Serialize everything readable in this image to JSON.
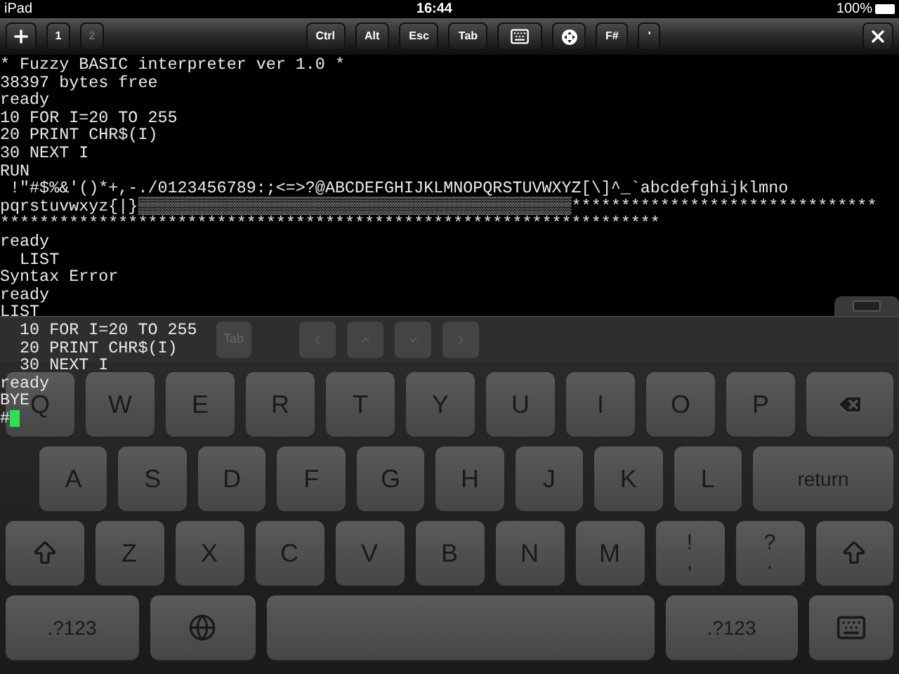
{
  "status_bar": {
    "device": "iPad",
    "time": "16:44",
    "battery": "100%"
  },
  "toolbar": {
    "sessions": [
      {
        "label": "1",
        "selected": true
      },
      {
        "label": "2",
        "selected": false
      }
    ],
    "keys": [
      "Ctrl",
      "Alt",
      "Esc",
      "Tab"
    ],
    "extra_keys": [
      "F#",
      "'"
    ]
  },
  "terminal": {
    "lines": [
      "* Fuzzy BASIC interpreter ver 1.0 *",
      "38397 bytes free",
      "ready",
      "10 FOR I=20 TO 255",
      "20 PRINT CHR$(I)",
      "30 NEXT I",
      "RUN",
      " !\"#$%&'()*+,-./0123456789:;<=>?@ABCDEFGHIJKLMNOPQRSTUVWXYZ[\\]^_`abcdefghijklmno",
      "pqrstuvwxyz{|}▒▒▒▒▒▒▒▒▒▒▒▒▒▒▒▒▒▒▒▒▒▒▒▒▒▒▒▒▒▒▒▒▒▒▒▒▒▒▒▒▒▒▒▒*******************************",
      "*******************************************************************",
      "ready",
      "  LIST",
      "Syntax Error",
      "ready",
      "LIST",
      "  10 FOR I=20 TO 255",
      "  20 PRINT CHR$(I)",
      "  30 NEXT I",
      "ready",
      "BYE",
      "#"
    ]
  },
  "accessory_bar": {
    "keys": [
      "Tab"
    ]
  },
  "keyboard": {
    "rows": [
      [
        {
          "kind": "letter",
          "label": "Q"
        },
        {
          "kind": "letter",
          "label": "W"
        },
        {
          "kind": "letter",
          "label": "E"
        },
        {
          "kind": "letter",
          "label": "R"
        },
        {
          "kind": "letter",
          "label": "T"
        },
        {
          "kind": "letter",
          "label": "Y"
        },
        {
          "kind": "letter",
          "label": "U"
        },
        {
          "kind": "letter",
          "label": "I"
        },
        {
          "kind": "letter",
          "label": "O"
        },
        {
          "kind": "letter",
          "label": "P"
        },
        {
          "kind": "backspace"
        }
      ],
      [
        {
          "kind": "letter",
          "label": "A"
        },
        {
          "kind": "letter",
          "label": "S"
        },
        {
          "kind": "letter",
          "label": "D"
        },
        {
          "kind": "letter",
          "label": "F"
        },
        {
          "kind": "letter",
          "label": "G"
        },
        {
          "kind": "letter",
          "label": "H"
        },
        {
          "kind": "letter",
          "label": "J"
        },
        {
          "kind": "letter",
          "label": "K"
        },
        {
          "kind": "letter",
          "label": "L"
        },
        {
          "kind": "return",
          "label": "return"
        }
      ],
      [
        {
          "kind": "shift"
        },
        {
          "kind": "letter",
          "label": "Z"
        },
        {
          "kind": "letter",
          "label": "X"
        },
        {
          "kind": "letter",
          "label": "C"
        },
        {
          "kind": "letter",
          "label": "V"
        },
        {
          "kind": "letter",
          "label": "B"
        },
        {
          "kind": "letter",
          "label": "N"
        },
        {
          "kind": "letter",
          "label": "M"
        },
        {
          "kind": "punct",
          "top": "!",
          "bottom": ","
        },
        {
          "kind": "punct",
          "top": "?",
          "bottom": "."
        },
        {
          "kind": "shift"
        }
      ],
      [
        {
          "kind": "numbers",
          "label": ".?123"
        },
        {
          "kind": "globe"
        },
        {
          "kind": "space"
        },
        {
          "kind": "numbers",
          "label": ".?123"
        },
        {
          "kind": "hide"
        }
      ]
    ]
  }
}
